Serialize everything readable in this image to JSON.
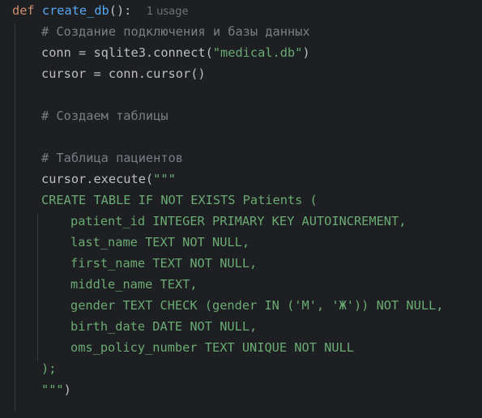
{
  "code": {
    "line1": {
      "keyword": "def",
      "func_name": "create_db",
      "signature_rest": "():",
      "usage_hint": "1 usage"
    },
    "line2": {
      "comment": "# Создание подключения и базы данных"
    },
    "line3": {
      "prefix": "conn = sqlite3.connect(",
      "string": "\"medical.db\"",
      "suffix": ")"
    },
    "line4": {
      "text": "cursor = conn.cursor()"
    },
    "line6": {
      "comment": "# Создаем таблицы"
    },
    "line8": {
      "comment": "# Таблица пациентов"
    },
    "line9": {
      "prefix": "cursor.execute(",
      "string": "\"\"\""
    },
    "sql_lines": [
      "CREATE TABLE IF NOT EXISTS Patients (",
      "patient_id INTEGER PRIMARY KEY AUTOINCREMENT,",
      "last_name TEXT NOT NULL,",
      "first_name TEXT NOT NULL,",
      "middle_name TEXT,",
      "gender TEXT CHECK (gender IN ('М', 'Ж')) NOT NULL,",
      "birth_date DATE NOT NULL,",
      "oms_policy_number TEXT UNIQUE NOT NULL",
      ");"
    ],
    "line19": {
      "string": "\"\"\"",
      "suffix": ")"
    }
  },
  "colors": {
    "background": "#1e1f22",
    "keyword": "#cf8e6d",
    "function": "#56a8f5",
    "comment": "#7a7e85",
    "string": "#6aab73",
    "plain": "#bcbec4",
    "hint": "#6f737a"
  }
}
